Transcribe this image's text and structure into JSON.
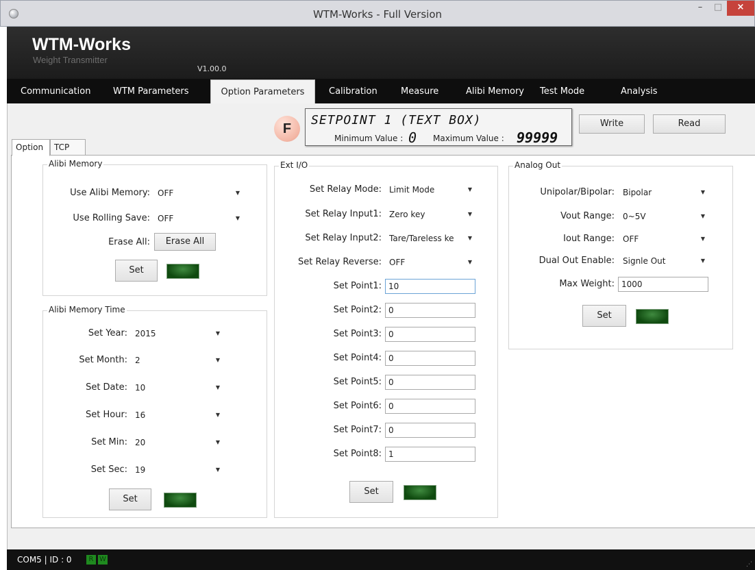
{
  "window": {
    "title": "WTM-Works - Full Version",
    "min_glyph": "–",
    "max_glyph": "□",
    "close_glyph": "×"
  },
  "header": {
    "brand": "WTM-Works",
    "subtitle": "Weight Transmitter",
    "version": "V1.00.0"
  },
  "menu": [
    "Communication",
    "WTM Parameters",
    "Option Parameters",
    "Calibration",
    "Measure",
    "Alibi Memory",
    "Test Mode",
    "Analysis"
  ],
  "active_menu": "Option Parameters",
  "callout": {
    "badge": "F",
    "title": "SETPOINT 1 (TEXT BOX)",
    "min_label": "Minimum Value :",
    "min_value": "0",
    "max_label": "Maximum Value :",
    "max_value": "99999"
  },
  "actions": {
    "write": "Write",
    "read": "Read"
  },
  "tabs": [
    "Option",
    "TCP"
  ],
  "alibi_memory": {
    "title": "Alibi Memory",
    "use_alibi_label": "Use Alibi Memory:",
    "use_alibi_value": "OFF",
    "use_rolling_label": "Use Rolling Save:",
    "use_rolling_value": "OFF",
    "erase_label": "Erase All:",
    "erase_button": "Erase All",
    "set_button": "Set"
  },
  "alibi_time": {
    "title": "Alibi Memory Time",
    "rows": [
      {
        "label": "Set Year:",
        "value": "2015"
      },
      {
        "label": "Set Month:",
        "value": "2"
      },
      {
        "label": "Set Date:",
        "value": "10"
      },
      {
        "label": "Set Hour:",
        "value": "16"
      },
      {
        "label": "Set Min:",
        "value": "20"
      },
      {
        "label": "Set Sec:",
        "value": "19"
      }
    ],
    "set_button": "Set"
  },
  "ext_io": {
    "title": "Ext I/O",
    "combos": [
      {
        "label": "Set Relay Mode:",
        "value": "Limit Mode"
      },
      {
        "label": "Set Relay Input1:",
        "value": "Zero key"
      },
      {
        "label": "Set Relay Input2:",
        "value": "Tare/Tareless ke"
      },
      {
        "label": "Set Relay Reverse:",
        "value": "OFF"
      }
    ],
    "points": [
      {
        "label": "Set Point1:",
        "value": "10"
      },
      {
        "label": "Set Point2:",
        "value": "0"
      },
      {
        "label": "Set Point3:",
        "value": "0"
      },
      {
        "label": "Set Point4:",
        "value": "0"
      },
      {
        "label": "Set Point5:",
        "value": "0"
      },
      {
        "label": "Set Point6:",
        "value": "0"
      },
      {
        "label": "Set Point7:",
        "value": "0"
      },
      {
        "label": "Set Point8:",
        "value": "1"
      }
    ],
    "set_button": "Set"
  },
  "analog_out": {
    "title": "Analog Out",
    "combos": [
      {
        "label": "Unipolar/Bipolar:",
        "value": "Bipolar"
      },
      {
        "label": "Vout Range:",
        "value": "0~5V"
      },
      {
        "label": "Iout Range:",
        "value": "OFF"
      },
      {
        "label": "Dual Out Enable:",
        "value": "Signle Out"
      }
    ],
    "max_weight_label": "Max Weight:",
    "max_weight_value": "1000",
    "set_button": "Set"
  },
  "status": {
    "text": "COM5 | ID : 0",
    "r": "R",
    "w": "W",
    "indicator_color": "#1f8a1f"
  },
  "colors": {
    "menu_bar": "#0e0e0e",
    "header": "#2e2e2e",
    "led_on": "#1f6b1f",
    "close_button": "#c6433b"
  }
}
